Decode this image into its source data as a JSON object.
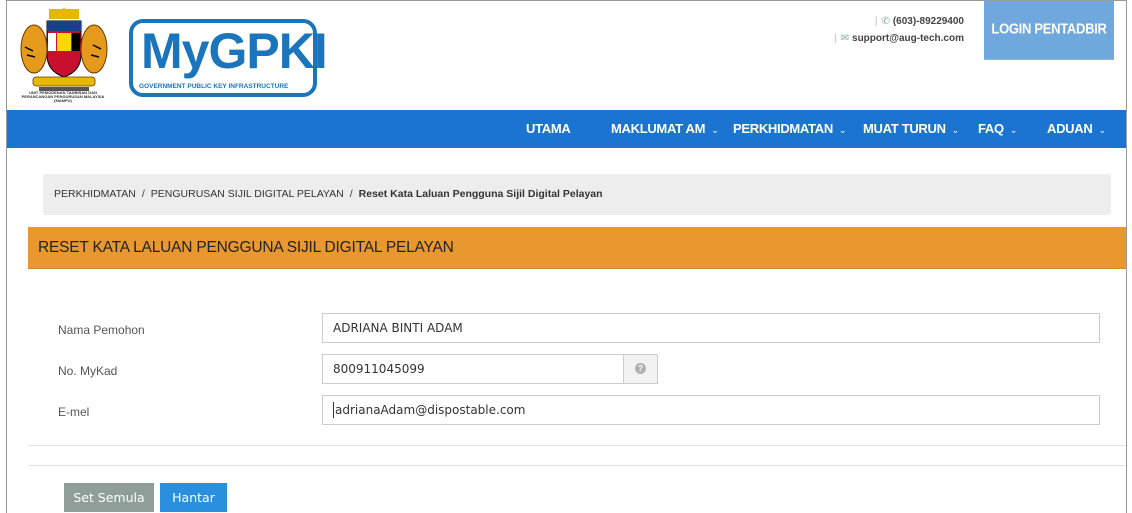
{
  "header": {
    "logo_text": "MyGPKI",
    "logo_subtitle": "GOVERNMENT PUBLIC KEY INFRASTRUCTURE",
    "crest_caption": "UNIT PEMODENAN TADBIRAN DAN PERANCANGAN PENGURUSAN MALAYSIA (MAMPU)",
    "phone": "(603)-89229400",
    "email": "support@aug-tech.com",
    "login_label": "LOGIN PENTADBIR"
  },
  "nav": {
    "items": [
      {
        "label": "UTAMA",
        "has_dropdown": false
      },
      {
        "label": "MAKLUMAT AM",
        "has_dropdown": true
      },
      {
        "label": "PERKHIDMATAN",
        "has_dropdown": true
      },
      {
        "label": "MUAT TURUN",
        "has_dropdown": true
      },
      {
        "label": "FAQ",
        "has_dropdown": true
      },
      {
        "label": "ADUAN",
        "has_dropdown": true
      }
    ]
  },
  "breadcrumb": {
    "items": [
      "PERKHIDMATAN",
      "PENGURUSAN SIJIL DIGITAL PELAYAN"
    ],
    "separator": "/",
    "active": "Reset Kata Laluan Pengguna Sijil Digital Pelayan"
  },
  "panel": {
    "title": "RESET KATA LALUAN PENGGUNA SIJIL DIGITAL PELAYAN",
    "header_color": "#e8982e"
  },
  "form": {
    "name_label": "Nama Pemohon",
    "name_value": "ADRIANA BINTI ADAM",
    "mykad_label": "No. MyKad",
    "mykad_value": "800911045099",
    "email_label": "E-mel",
    "email_value": "adrianaAdam@dispostable.com"
  },
  "buttons": {
    "reset_label": "Set Semula",
    "submit_label": "Hantar"
  },
  "colors": {
    "nav_bg": "#1b75d0",
    "login_bg": "#6fa8dc",
    "reset_bg": "#8f9e98",
    "submit_bg": "#2b8fe0"
  }
}
